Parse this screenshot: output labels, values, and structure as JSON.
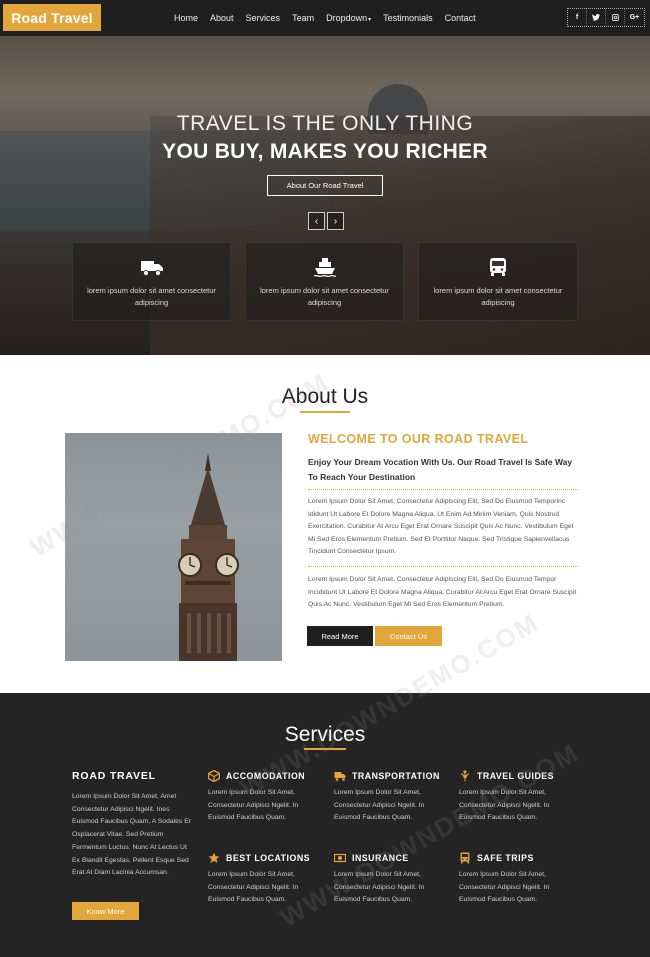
{
  "header": {
    "logo": "Road Travel",
    "nav": [
      "Home",
      "About",
      "Services",
      "Team",
      "Dropdown",
      "Testimonials",
      "Contact"
    ],
    "social": [
      "f",
      "t",
      "ig",
      "G+"
    ]
  },
  "hero": {
    "line1": "TRAVEL IS THE ONLY THING",
    "line2": "YOU BUY, MAKES YOU RICHER",
    "button": "About Our Road Travel",
    "prev": "‹",
    "next": "›",
    "cards": [
      {
        "icon": "truck-icon",
        "text": "lorem ipsum dolor sit amet consectetur adipiscing"
      },
      {
        "icon": "ship-icon",
        "text": "lorem ipsum dolor sit amet consectetur adipiscing"
      },
      {
        "icon": "bus-icon",
        "text": "lorem ipsum dolor sit amet consectetur adipiscing"
      }
    ]
  },
  "about": {
    "title": "About Us",
    "welcome": "WELCOME TO OUR ROAD TRAVEL",
    "subtitle": "Enjoy Your Dream Vocation With Us. Our Road Travel Is Safe Way To Reach Your Destination",
    "para1": "Lorem Ipsum Dolor Sit Amet, Consectetur Adipiscing Elit, Sed Do Eiusmod Temporinc Ididunt Ut Labore Et Dolore Magna Aliqua. Ut Enim Ad Minim Veniam, Quis Nostrud Exercitation. Curabitur At Arcu Eget Erat Ornare Suscipit Quis Ac Nunc. Vestibulum Eget Mi Sed Eros Elementum Pretium. Sed Et Porttitor Neque. Sed Tristique Sapienvellacus Tincidunt Consectetur Ipsum.",
    "para2": "Lorem Ipsum Dolor Sit Amet, Consectetur Adipiscing Elit, Sed Do Eiusmod Tempor Incididunt Ut Labore Et Dolore Magna Aliqua. Curabitur At Arcu Eget Erat Ornare Suscipit Quis Ac Nunc. Vestibulum Eget Mi Sed Eros Elementum Pretium.",
    "read_more": "Read More",
    "contact_us": "Contact Us"
  },
  "services": {
    "title": "Services",
    "road_travel_title": "ROAD TRAVEL",
    "road_travel_text": "Lorem Ipsum Dolor Sit Amet, Amet Consectetur Adipisci Ngelit. Ines Euismod Faucibus Quam, A Sodales Er Osplacerat Vitae. Sed Pretium Fermentum Luctus. Nunc At Lectus Ut Ex Blandit Egestas. Pellent Esque Sed Erat At Diam Lacinia Accumsan.",
    "know_more": "Know More",
    "items": [
      {
        "title": "ACCOMODATION",
        "icon": "cube-icon",
        "text": "Lorem Ipsum Dolor Sit Amet, Consectetur Adipisci Ngelit. In Euismod Faucibus Quam."
      },
      {
        "title": "TRANSPORTATION",
        "icon": "truck-icon",
        "text": "Lorem Ipsum Dolor Sit Amet, Consectetur Adipisci Ngelit. In Euismod Faucibus Quam."
      },
      {
        "title": "TRAVEL GUIDES",
        "icon": "person-icon",
        "text": "Lorem Ipsum Dolor Sit Amet, Consectetur Adipisci Ngelit. In Euismod Faucibus Quam."
      },
      {
        "title": "BEST LOCATIONS",
        "icon": "star-icon",
        "text": "Lorem Ipsum Dolor Sit Amet, Consectetur Adipisci Ngelit. In Euismod Faucibus Quam."
      },
      {
        "title": "INSURANCE",
        "icon": "money-icon",
        "text": "Lorem Ipsum Dolor Sit Amet, Consectetur Adipisci Ngelit. In Euismod Faucibus Quam."
      },
      {
        "title": "SAFE TRIPS",
        "icon": "bus-icon",
        "text": "Lorem Ipsum Dolor Sit Amet, Consectetur Adipisci Ngelit. In Euismod Faucibus Quam."
      }
    ]
  },
  "watermark": "WWW.DOWNDEMO.COM",
  "colors": {
    "accent": "#e2a63b",
    "dark": "#1f1f1f",
    "services_bg": "#242424"
  }
}
